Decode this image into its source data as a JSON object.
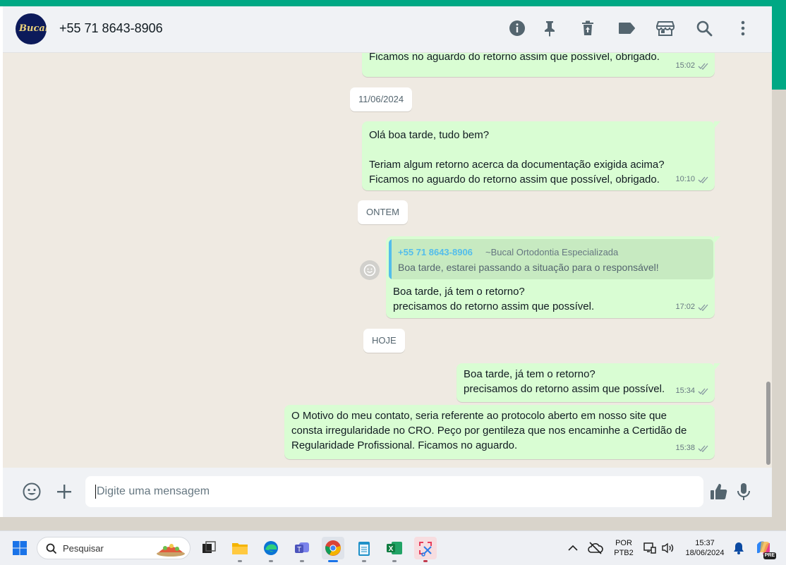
{
  "header": {
    "contact_name": "+55 71 8643-8906",
    "avatar_text": "Bucal",
    "icons": [
      "info-icon",
      "pin-icon",
      "trash-icon",
      "label-icon",
      "store-icon",
      "search-icon",
      "more-vertical-icon"
    ]
  },
  "messages": [
    {
      "text": "Ficamos no aguardo do retorno assim que possível, obrigado.",
      "time": "15:02"
    },
    {
      "text": "Olá boa tarde, tudo bem?\n\nTeriam algum retorno acerca da documentação exigida acima?\nFicamos no aguardo do retorno assim que possível, obrigado.",
      "time": "10:10"
    },
    {
      "text": "Boa tarde, já tem o retorno?\nprecisamos do retorno assim que possível.",
      "time": "17:02"
    },
    {
      "text": "Boa tarde, já tem o retorno?\nprecisamos do retorno assim que possível.",
      "time": "15:34"
    },
    {
      "text": "O Motivo do meu contato, seria referente ao protocolo aberto em nosso site que\nconsta irregularidade no CRO. Peço por gentileza que nos encaminhe a Certidão de\nRegularidade Profissional. Ficamos no aguardo.",
      "time": "15:38"
    }
  ],
  "dates": [
    "11/06/2024",
    "ONTEM",
    "HOJE"
  ],
  "quote": {
    "author": "+55 71 8643-8906",
    "org": "~Bucal Ortodontia Especializada",
    "text": "Boa tarde, estarei passando a situação para o responsável!"
  },
  "footer": {
    "placeholder": "Digite uma mensagem"
  },
  "taskbar": {
    "search_label": "Pesquisar",
    "lang_line1": "POR",
    "lang_line2": "PTB2",
    "time": "15:37",
    "date": "18/06/2024",
    "copilot_badge": "PRE"
  },
  "colors": {
    "accent": "#00a884",
    "outgoing_bubble": "#d9fdd3",
    "chat_bg": "#efeae2",
    "quote_author": "#53bdeb"
  }
}
